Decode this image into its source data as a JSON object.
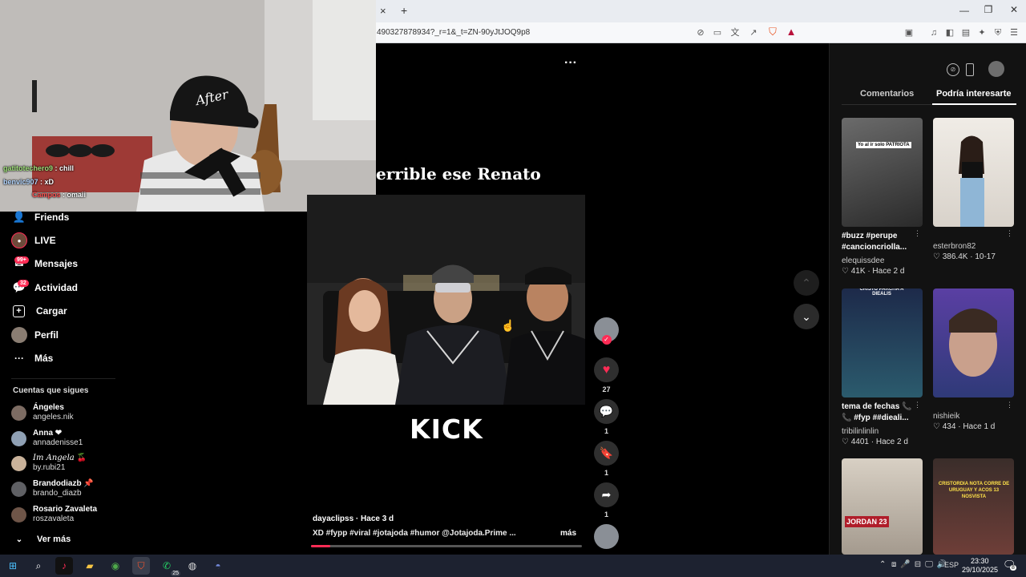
{
  "browser": {
    "url": "490327878934?_r=1&_t=ZN-90yJtJOQ9p8",
    "new_tab_symbol": "+",
    "close_tab_symbol": "×"
  },
  "webcam": {
    "cap_text": "After",
    "chat": [
      {
        "user": "gatitotechero9",
        "message": " : chill",
        "color": "#9fe07a"
      },
      {
        "user": "benvic907",
        "message": " : xD",
        "color": "#b4d6ff"
      },
      {
        "user": "Campos",
        "message": " : omaii",
        "color": "#ff4d4d"
      }
    ]
  },
  "sidebar": {
    "nav": [
      {
        "label": "Friends",
        "icon": "friends-icon",
        "glyph": "👤"
      },
      {
        "label": "LIVE",
        "icon": "live-icon",
        "glyph": "●"
      },
      {
        "label": "Mensajes",
        "icon": "messages-icon",
        "glyph": "✉",
        "badge": "99+"
      },
      {
        "label": "Actividad",
        "icon": "activity-icon",
        "glyph": "💬",
        "badge": "32"
      },
      {
        "label": "Cargar",
        "icon": "upload-icon",
        "glyph": "＋"
      },
      {
        "label": "Perfil",
        "icon": "profile-icon",
        "glyph": "●"
      },
      {
        "label": "Más",
        "icon": "more-icon",
        "glyph": "···"
      }
    ],
    "following_header": "Cuentas que sigues",
    "following": [
      {
        "name": "Ángeles",
        "user": "angeles.nik"
      },
      {
        "name": "Anna ❤",
        "user": "annadenisse1"
      },
      {
        "name": "𝐼𝑚 𝐴𝑛𝑔𝑒𝑙𝑎 🍒",
        "user": "by.rubi21"
      },
      {
        "name": "Brandodiazb 📌",
        "user": "brando_diazb"
      },
      {
        "name": "Rosario Zavaleta",
        "user": "roszavaleta"
      }
    ],
    "see_more": "Ver más"
  },
  "video": {
    "title_overlay": "errible ese Renato",
    "watermark": "KICK",
    "author_line": "dayaclipss · Hace 3 d",
    "caption": "XD #fypp #viral #jotajoda #humor @Jotajoda.Prime ...",
    "more_label": "más",
    "more_menu": "···",
    "progress": 0.07
  },
  "actions": {
    "likes": "27",
    "comments": "1",
    "saves": "1",
    "shares": "1"
  },
  "right_panel": {
    "tabs": [
      "Comentarios",
      "Podría interesarte"
    ],
    "active_tab": 1,
    "items": [
      {
        "thumb_text": "Yo al ir solo PATRIOTA",
        "title": "#buzz #perupe #cancioncriolla...",
        "user": "elequissdee",
        "stats": "♡ 41K · Hace 2 d",
        "col": 0,
        "row": 0
      },
      {
        "thumb_text": "",
        "title": "",
        "user": "esterbron82",
        "stats": "♡ 386.4K · 10-17",
        "col": 1,
        "row": 0
      },
      {
        "thumb_text": "CRISTO PARCHA A DIEALIS",
        "title": "tema de fechas 📞 📞 #fyp ##dieali...",
        "user": "tribilinlinlin",
        "stats": "♡ 4401 · Hace 2 d",
        "col": 0,
        "row": 1
      },
      {
        "thumb_text": "",
        "title": "",
        "user": "nishieik",
        "stats": "♡ 434 · Hace 1 d",
        "col": 1,
        "row": 1
      },
      {
        "thumb_text": "JORDAN 23",
        "title": "",
        "user": "",
        "stats": "",
        "col": 0,
        "row": 2
      },
      {
        "thumb_text": "CRISTORDIA NOTA CORRE DE URUGUAY Y ACOS 13 NOSVISTA",
        "title": "",
        "user": "",
        "stats": "",
        "col": 1,
        "row": 2
      }
    ]
  },
  "taskbar": {
    "language": "ESP",
    "time": "23:30",
    "date": "29/10/2025",
    "whatsapp_badge": "25",
    "notif_count": "8"
  }
}
